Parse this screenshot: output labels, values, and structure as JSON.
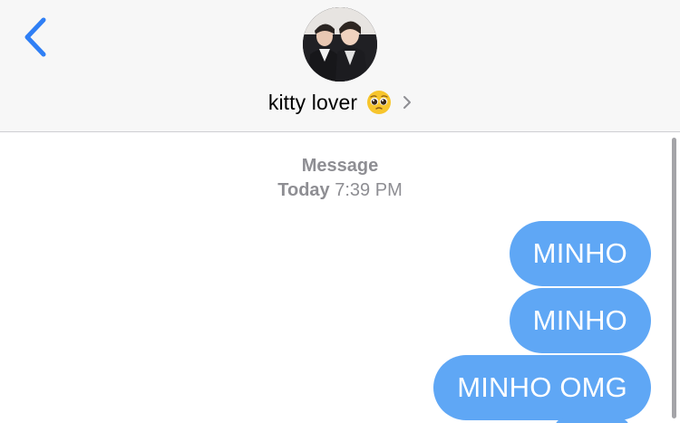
{
  "header": {
    "contact_name": "kitty lover",
    "emoji": "pleading-face-emoji",
    "back_icon": "chevron-left-icon",
    "chevron_icon": "chevron-right-icon",
    "accent_color": "#2f7ff5"
  },
  "thread": {
    "service_label": "Message",
    "timestamp_day": "Today",
    "timestamp_time": "7:39 PM",
    "messages": [
      {
        "text": "MINHO",
        "sender": "me"
      },
      {
        "text": "MINHO",
        "sender": "me"
      },
      {
        "text": "MINHO OMG",
        "sender": "me"
      }
    ],
    "bubble_color": "#5fa7f5"
  }
}
